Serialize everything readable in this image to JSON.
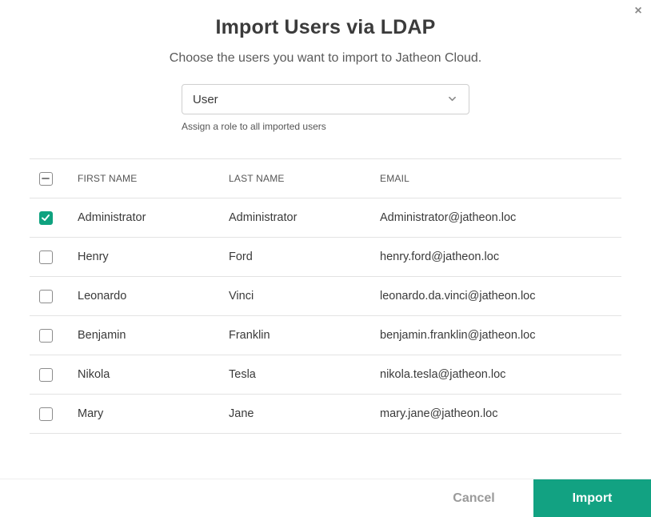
{
  "dialog": {
    "close_label": "×",
    "title": "Import Users via LDAP",
    "subtitle": "Choose the users you want to import to Jatheon Cloud."
  },
  "role": {
    "selected": "User",
    "hint": "Assign a role to all imported users",
    "icon": "chevron-down-icon"
  },
  "table": {
    "select_all_state": "indeterminate",
    "columns": [
      "FIRST NAME",
      "LAST NAME",
      "EMAIL"
    ],
    "rows": [
      {
        "first": "Administrator",
        "last": "Administrator",
        "email": "Administrator@jatheon.loc",
        "checked": true
      },
      {
        "first": "Henry",
        "last": "Ford",
        "email": "henry.ford@jatheon.loc",
        "checked": false
      },
      {
        "first": "Leonardo",
        "last": "Vinci",
        "email": "leonardo.da.vinci@jatheon.loc",
        "checked": false
      },
      {
        "first": "Benjamin",
        "last": "Franklin",
        "email": "benjamin.franklin@jatheon.loc",
        "checked": false
      },
      {
        "first": "Nikola",
        "last": "Tesla",
        "email": "nikola.tesla@jatheon.loc",
        "checked": false
      },
      {
        "first": "Mary",
        "last": "Jane",
        "email": "mary.jane@jatheon.loc",
        "checked": false
      }
    ]
  },
  "footer": {
    "cancel_label": "Cancel",
    "import_label": "Import"
  },
  "colors": {
    "accent": "#12a282",
    "checkbox_checked": "#0fa27f"
  }
}
